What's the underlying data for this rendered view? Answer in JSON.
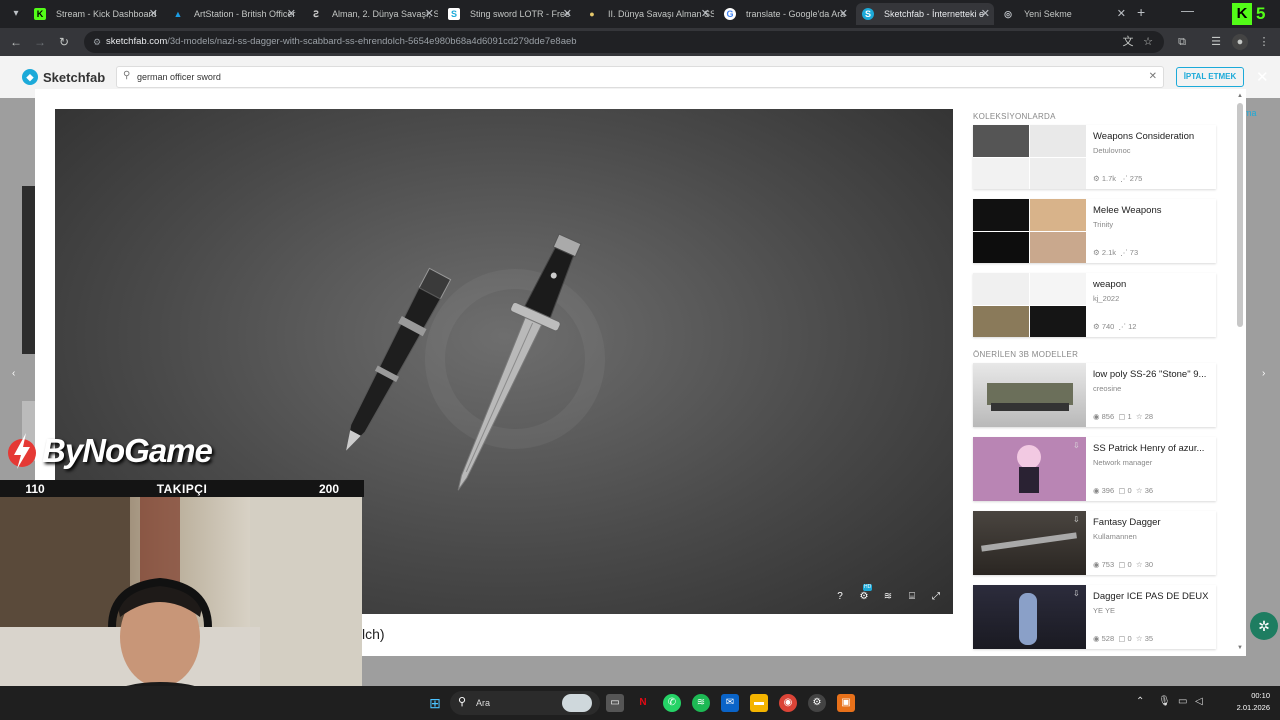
{
  "browser": {
    "tabs": [
      {
        "title": "Stream - Kick Dashboard",
        "favicon": "kick-icon",
        "active": false
      },
      {
        "title": "ArtStation - British Officer",
        "favicon": "artstation-icon",
        "active": false
      },
      {
        "title": "Alman, 2. Dünya Savaşı, S",
        "favicon": "generic-site-icon",
        "active": false
      },
      {
        "title": "Sting sword LOTR - Free",
        "favicon": "sketchfab-icon",
        "active": false
      },
      {
        "title": "II. Dünya Savaşı Alman SS",
        "favicon": "generic-site-icon",
        "active": false
      },
      {
        "title": "translate - Google'da Ara",
        "favicon": "google-icon",
        "active": false
      },
      {
        "title": "Sketchfab - İnternetteki e",
        "favicon": "sketchfab-icon",
        "active": true
      },
      {
        "title": "Yeni Sekme",
        "favicon": "chrome-icon",
        "active": false
      }
    ],
    "url_domain": "sketchfab.com",
    "url_path": "/3d-models/nazi-ss-dagger-with-scabbard-ss-ehrendolch-5654e980b68a4d6091cd279dde7e8aeb",
    "kick_badge_letter": "K",
    "kick_badge_number": "5"
  },
  "sketchfab": {
    "logo_text": "Sketchfab",
    "search_value": "german officer sword",
    "cancel_label": "İPTAL ETMEK",
    "behind_link": "ma"
  },
  "modal": {
    "title_tail": "lch)",
    "collections_heading": "KOLEKSİYONLARDA",
    "recommended_heading": "ÖNERİLEN 3B MODELLER",
    "collections": [
      {
        "title": "Weapons Consideration",
        "author": "Detulovnoc",
        "stat1": "1.7k",
        "stat2": "275"
      },
      {
        "title": "Melee Weapons",
        "author": "Trinity",
        "stat1": "2.1k",
        "stat2": "73"
      },
      {
        "title": "weapon",
        "author": "kj_2022",
        "stat1": "740",
        "stat2": "12"
      }
    ],
    "recommended": [
      {
        "title": "low poly SS-26 \"Stone\" 9...",
        "author": "creosine",
        "views": "856",
        "comments": "1",
        "likes": "28"
      },
      {
        "title": "SS Patrick Henry of azur...",
        "author": "Network manager",
        "views": "396",
        "comments": "0",
        "likes": "36"
      },
      {
        "title": "Fantasy Dagger",
        "author": "Kullamannen",
        "views": "753",
        "comments": "0",
        "likes": "30"
      },
      {
        "title": "Dagger ICE PAS DE DEUX",
        "author": "YE YE",
        "views": "528",
        "comments": "0",
        "likes": "35"
      }
    ],
    "viewer_controls": [
      "help-icon",
      "settings-icon",
      "layers-icon",
      "vr-icon",
      "fullscreen-icon"
    ],
    "hd_badge": "HD"
  },
  "stream_overlay": {
    "brand": "ByNoGame",
    "follow_current": "110",
    "follow_label": "TAKIPÇI",
    "follow_goal": "200"
  },
  "taskbar": {
    "search_label": "Ara",
    "time": "00:10",
    "date": "2.01.2026"
  },
  "colors": {
    "sketchfab_blue": "#1caad9",
    "kick_green": "#53fc18",
    "tab_bg": "#202124",
    "toolbar_bg": "#35363a"
  }
}
